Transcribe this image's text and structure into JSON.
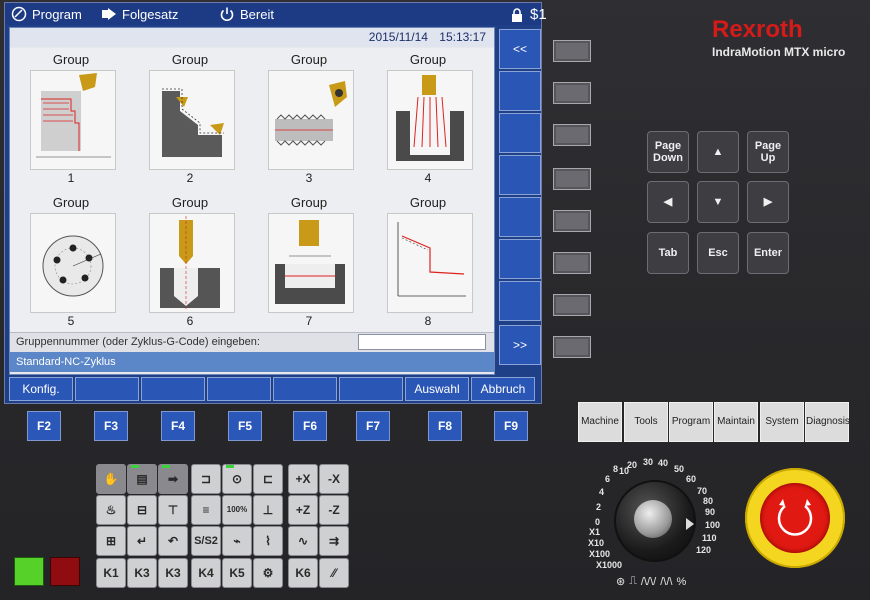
{
  "status": {
    "program_label": "Program",
    "folgesatz_label": "Folgesatz",
    "bereit_label": "Bereit",
    "channel": "$1"
  },
  "datetime": {
    "date": "2015/11/14",
    "time": "15:13:17"
  },
  "groups": [
    {
      "label": "Group",
      "number": "1"
    },
    {
      "label": "Group",
      "number": "2"
    },
    {
      "label": "Group",
      "number": "3"
    },
    {
      "label": "Group",
      "number": "4"
    },
    {
      "label": "Group",
      "number": "5"
    },
    {
      "label": "Group",
      "number": "6"
    },
    {
      "label": "Group",
      "number": "7"
    },
    {
      "label": "Group",
      "number": "8"
    }
  ],
  "input": {
    "prompt": "Gruppennummer (oder Zyklus-G-Code) eingeben:",
    "value": ""
  },
  "nc_title": "Standard-NC-Zyklus",
  "vertical_softkeys": {
    "top": "<<",
    "bottom": ">>"
  },
  "horizontal_softkeys": {
    "konfig": "Konfig.",
    "auswahl": "Auswahl",
    "abbruch": "Abbruch"
  },
  "brand": {
    "name": "Rexroth",
    "model": "IndraMotion MTX micro"
  },
  "nav_keys": {
    "page_down": "Page Down",
    "page_up": "Page Up",
    "tab": "Tab",
    "esc": "Esc",
    "enter": "Enter"
  },
  "function_keys": [
    "F2",
    "F3",
    "F4",
    "F5",
    "F6",
    "F7",
    "F8",
    "F9"
  ],
  "mode_keys": [
    "Machine",
    "Tools",
    "Program",
    "Maintain",
    "System",
    "Diagnosis"
  ],
  "operator_keys": {
    "k_labels": [
      "K1",
      "K3",
      "K3",
      "K4",
      "K5",
      "K6"
    ],
    "plus_x": "+X",
    "minus_x": "-X",
    "plus_z": "+Z",
    "minus_z": "-Z",
    "s_over_s": "S/S2",
    "percent": "100%"
  },
  "dial": {
    "scale": [
      "0",
      "2",
      "4",
      "6",
      "8",
      "10",
      "20",
      "30",
      "40",
      "50",
      "60",
      "70",
      "80",
      "90",
      "100",
      "110",
      "120"
    ],
    "multipliers": [
      "X1",
      "X10",
      "X100",
      "X1000"
    ],
    "percent_sign": "%"
  }
}
